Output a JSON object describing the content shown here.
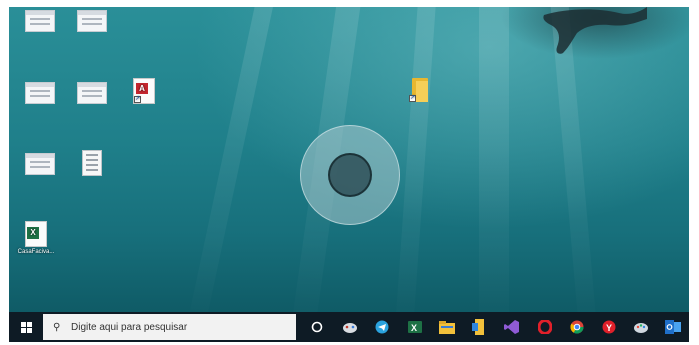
{
  "desktop": {
    "icons": [
      {
        "label": "",
        "kind": "window"
      },
      {
        "label": "",
        "kind": "window"
      },
      {
        "label": "",
        "kind": "window"
      },
      {
        "label": "",
        "kind": "window"
      },
      {
        "label": "",
        "kind": "pdf"
      },
      {
        "label": "",
        "kind": "spreadsheet-window"
      },
      {
        "label": "",
        "kind": "document"
      },
      {
        "label": "CasaFaciva...",
        "kind": "excel"
      },
      {
        "label": "",
        "kind": "folder"
      }
    ],
    "touch_indicator": "touch-cursor-icon"
  },
  "taskbar": {
    "start_icon": "windows-logo-icon",
    "search_placeholder": "Digite aqui para pesquisar",
    "search_icon": "search-icon",
    "pinned": [
      {
        "name": "cortana-icon",
        "color": "#ffffff"
      },
      {
        "name": "xbox-icon",
        "color": "#e0e0e0"
      },
      {
        "name": "telegram-icon",
        "color": "#2aa3df"
      },
      {
        "name": "excel-app-icon",
        "color": "#1e7145"
      },
      {
        "name": "file-explorer-icon",
        "color": "#f2c13b"
      },
      {
        "name": "app-icon",
        "color": "#f2c13b"
      },
      {
        "name": "visual-studio-icon",
        "color": "#8f5bd6"
      },
      {
        "name": "opera-icon",
        "color": "#e0202a"
      },
      {
        "name": "chrome-icon",
        "color": "#f4b400"
      },
      {
        "name": "yandex-icon",
        "color": "#e0202a"
      },
      {
        "name": "paint-icon",
        "color": "#d0d8e0"
      },
      {
        "name": "outlook-icon",
        "color": "#1f6fc9"
      }
    ]
  }
}
